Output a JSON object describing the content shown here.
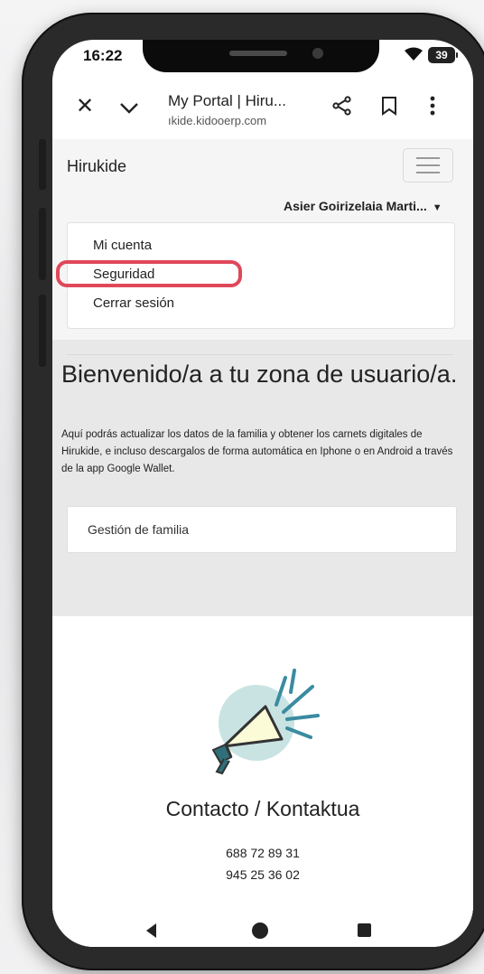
{
  "status_bar": {
    "time": "16:22",
    "battery": "39"
  },
  "browser": {
    "title": "My Portal | Hiru...",
    "url": "ıkide.kidooerp.com"
  },
  "site": {
    "brand": "Hirukide",
    "user_name": "Asier Goirizelaia Marti...",
    "menu_items": [
      "Mi cuenta",
      "Seguridad",
      "Cerrar sesión"
    ],
    "highlighted_item": "Seguridad",
    "highlight_color": "#e0485a"
  },
  "hero": {
    "title": "Bienvenido/a a tu zona de usuario/a.",
    "text": "Aquí podrás actualizar los datos de la familia y obtener los carnets digitales de Hirukide, e incluso descargalos de forma automática en Iphone o en Android a través de la app Google Wallet.",
    "card_label": "Gestión de familia"
  },
  "footer": {
    "contact_title": "Contacto / Kontaktua",
    "phones": [
      "688 72 89 31",
      "945 25 36 02"
    ]
  },
  "icons": {
    "close": "close-icon",
    "expand": "chevron-down-icon",
    "share": "share-icon",
    "bookmark": "bookmark-icon",
    "more": "more-vert-icon",
    "menu": "hamburger-icon",
    "contact": "megaphone-icon"
  }
}
